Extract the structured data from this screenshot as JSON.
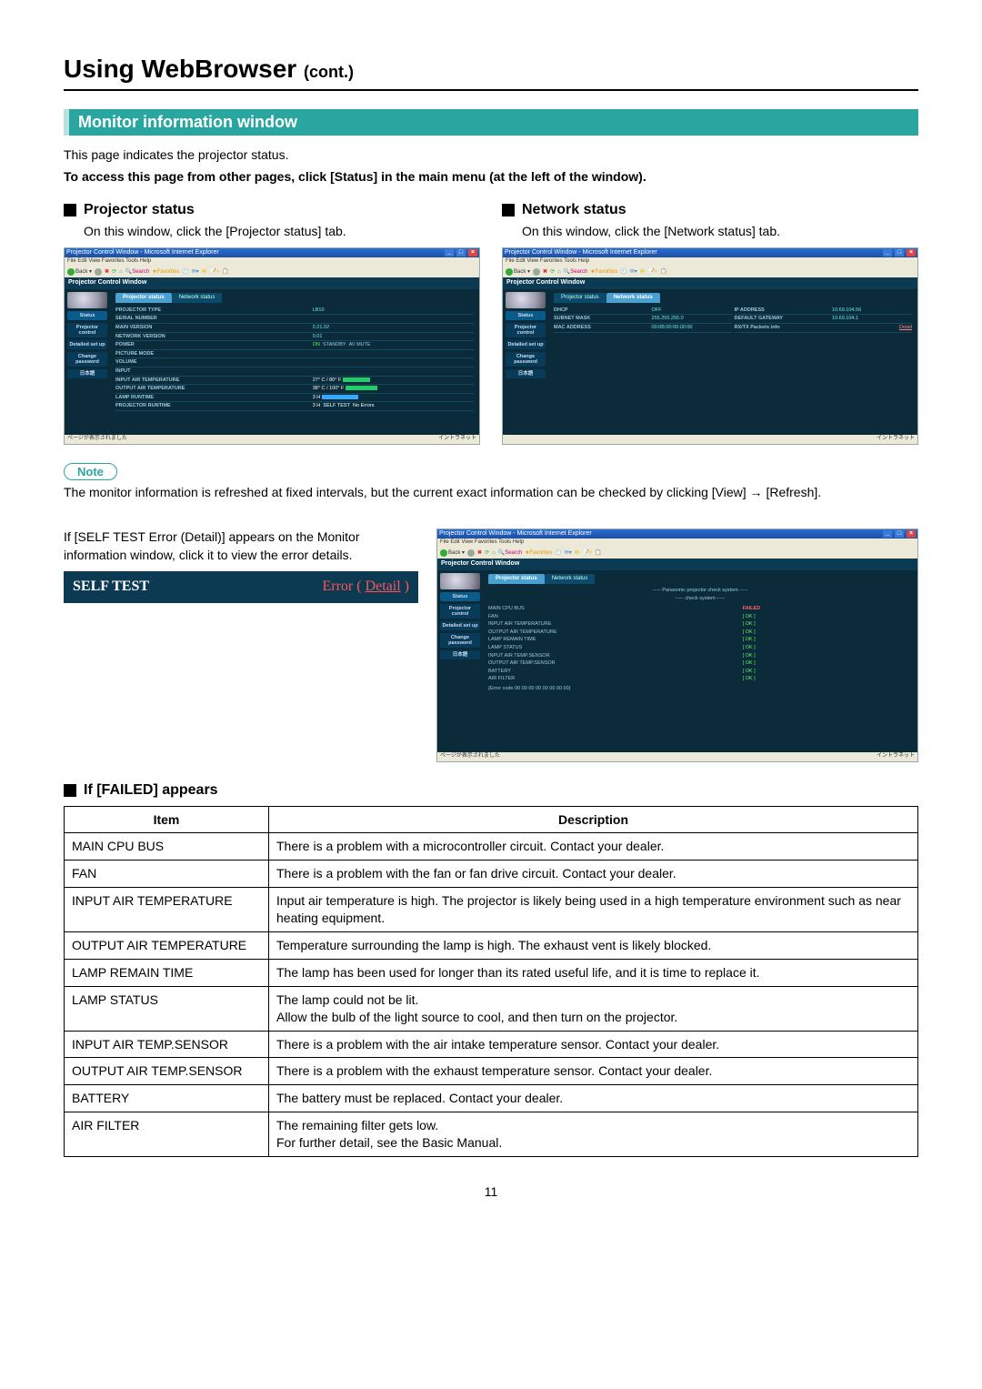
{
  "page": {
    "title_main": "Using WebBrowser",
    "title_cont": "(cont.)",
    "section_bar": "Monitor information window",
    "intro1": "This page indicates the projector status.",
    "intro2": "To access this page from other pages, click [Status] in the main menu (at the left of the window).",
    "page_number": "11"
  },
  "projector_status": {
    "heading": "Projector status",
    "text": "On this window, click the [Projector status] tab."
  },
  "network_status": {
    "heading": "Network status",
    "text": "On this window, click the [Network status] tab."
  },
  "mockwin_common": {
    "titlebar": "Projector Control Window - Microsoft Internet Explorer",
    "menubar": "File  Edit  View  Favorites  Tools  Help",
    "pcw": "Projector Control Window",
    "statusbar_left_1": "ページが表示されました",
    "statusbar_left_2": "ページが表示されました",
    "statusbar_right": "イントラネット"
  },
  "sidebar": {
    "items": [
      "Status",
      "Projector control",
      "Detailed set up",
      "Change password",
      "日本語"
    ]
  },
  "tabs": {
    "projector": "Projector status",
    "network": "Network status"
  },
  "proj_grid": {
    "r1l": "PROJECTOR TYPE",
    "r1v": "LB10",
    "r1l2": "SERIAL NUMBER",
    "r1v2": "",
    "r2l": "MAIN VERSION",
    "r2v": "0.21.02",
    "r2l2": "NETWORK VERSION",
    "r2v2": "0.01",
    "r3l": "POWER",
    "r3v": "ON",
    "r3l2": "STANDBY",
    "r3v2": "",
    "r3l3": "AV MUTE",
    "r3v3": "",
    "r4l": "PICTURE MODE",
    "r4v": "",
    "r4l2": "VOLUME",
    "r4v2": "",
    "r5l": "INPUT",
    "r5v": "",
    "r6l": "INPUT AIR TEMPERATURE",
    "r6v": "27° C / 80° F",
    "r7l": "OUTPUT AIR TEMPERATURE",
    "r7v": "38° C / 100° F",
    "r8l": "LAMP RUNTIME",
    "r8v": "3 H",
    "r9l": "PROJECTOR RUNTIME",
    "r9v": "3 H",
    "r9l2": "SELF TEST",
    "r9v2": "No Errors"
  },
  "net_grid": {
    "r1l": "DHCP",
    "r1v": "OFF",
    "r1l2": "IP ADDRESS",
    "r1v2": "10.69.104.56",
    "r2l": "SUBNET MASK",
    "r2v": "255.255.255.0",
    "r2l2": "DEFAULT GATEWAY",
    "r2v2": "10.69.104.1",
    "r3l": "MAC ADDRESS",
    "r3v": "00:0B:00:00:00:00",
    "r3l2": "RX/TX Packets info",
    "r3v2": "Detail"
  },
  "note": {
    "pill": "Note",
    "text": "The monitor information is refreshed at fixed intervals, but the current exact information can be checked by clicking [View] → [Refresh]."
  },
  "detail": {
    "para": "If [SELF TEST Error (Detail)] appears on the Monitor information window, click it to view the error details.",
    "strip_left": "SELF TEST",
    "strip_right_prefix": "Error ( ",
    "strip_right_link": "Detail",
    "strip_right_suffix": " )"
  },
  "err_panel": {
    "header": "----- Panasonic projector check system -----",
    "sub": "----- check system -----",
    "rows": [
      {
        "lbl": "MAIN CPU BUS",
        "st": "FAILED"
      },
      {
        "lbl": "FAN",
        "st": "[ OK ]"
      },
      {
        "lbl": "INPUT AIR TEMPERATURE",
        "st": "[ OK ]"
      },
      {
        "lbl": "OUTPUT AIR TEMPERATURE",
        "st": "[ OK ]"
      },
      {
        "lbl": "LAMP REMAIN TIME",
        "st": "[ OK ]"
      },
      {
        "lbl": "LAMP STATUS",
        "st": "[ OK ]"
      },
      {
        "lbl": "INPUT AIR TEMP.SENSOR",
        "st": "[ OK ]"
      },
      {
        "lbl": "OUTPUT AIR TEMP.SENSOR",
        "st": "[ OK ]"
      },
      {
        "lbl": "BATTERY",
        "st": "[ OK ]"
      },
      {
        "lbl": "AIR FILTER",
        "st": "[ OK ]"
      }
    ],
    "footer": "(Error code 00 00 00 00 00 00 00 00)"
  },
  "failed": {
    "heading": "If [FAILED] appears",
    "th_item": "Item",
    "th_desc": "Description",
    "rows": [
      {
        "item": "MAIN CPU BUS",
        "desc": "There is a problem with a microcontroller circuit. Contact your dealer."
      },
      {
        "item": "FAN",
        "desc": "There is a problem with the fan or fan drive circuit. Contact your dealer."
      },
      {
        "item": "INPUT AIR TEMPERATURE",
        "desc": "Input air temperature is high. The projector is likely being used in a high temperature environment such as near heating equipment."
      },
      {
        "item": "OUTPUT AIR TEMPERATURE",
        "desc": "Temperature surrounding the lamp is high. The exhaust vent is likely blocked."
      },
      {
        "item": "LAMP REMAIN TIME",
        "desc": "The lamp has been used for longer than its rated useful life, and it is time to replace it."
      },
      {
        "item": "LAMP STATUS",
        "desc": "The lamp could not be lit.\nAllow the bulb of the light source to cool, and then turn on the projector."
      },
      {
        "item": "INPUT AIR TEMP.SENSOR",
        "desc": "There is a problem with the air intake temperature sensor. Contact your dealer."
      },
      {
        "item": "OUTPUT AIR TEMP.SENSOR",
        "desc": "There is a problem with the exhaust temperature sensor. Contact your dealer."
      },
      {
        "item": "BATTERY",
        "desc": "The battery must be replaced. Contact your dealer."
      },
      {
        "item": "AIR FILTER",
        "desc": "The remaining filter gets low.\nFor further detail, see the Basic Manual."
      }
    ]
  }
}
